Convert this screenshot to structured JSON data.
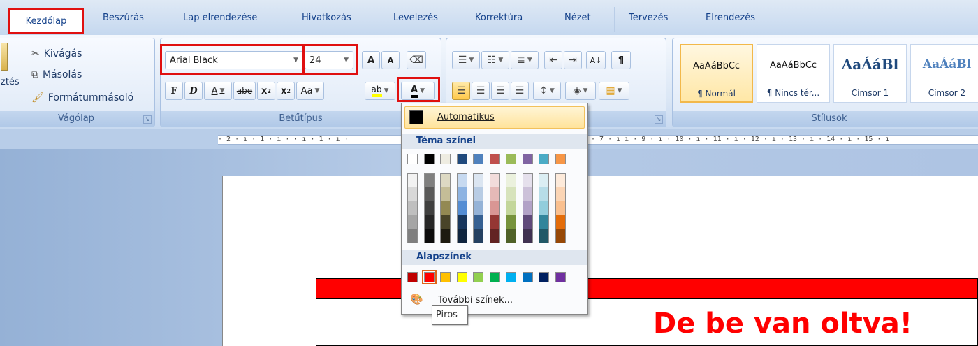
{
  "tabs": [
    "Kezdőlap",
    "Beszúrás",
    "Lap elrendezése",
    "Hivatkozás",
    "Levelezés",
    "Korrektúra",
    "Nézet",
    "Tervezés",
    "Elrendezés"
  ],
  "clipboard": {
    "paste_label": "ztés",
    "cut": "Kivágás",
    "copy": "Másolás",
    "format_painter": "Formátummásoló",
    "group_label": "Vágólap"
  },
  "font": {
    "name": "Arial Black",
    "size": "24",
    "grow": "A",
    "shrink": "A",
    "bold": "F",
    "italic": "D",
    "underline": "A",
    "strike": "abe",
    "subscript": "x",
    "superscript": "x",
    "change_case": "Aa",
    "highlight": "ab",
    "color_letter": "A",
    "group_label": "Betűtípus"
  },
  "paragraph": {
    "sort": "A↓",
    "pilcrow": "¶"
  },
  "styles": {
    "items": [
      {
        "sample": "AaÁáBbCc",
        "name": "¶ Normál"
      },
      {
        "sample": "AaÁáBbCc",
        "name": "¶ Nincs tér..."
      },
      {
        "sample": "AaÁáBl",
        "name": "Címsor 1"
      },
      {
        "sample": "AaÁáBl",
        "name": "Címsor 2"
      }
    ],
    "group_label": "Stílusok"
  },
  "ruler": {
    "left_text": "· 2 · ı · 1 · ı ·    · ı · 1 · ı ·",
    "right_text": "· 7 · ı        ı · 9 · ı · 10 · ı · 11 · ı · 12 · ı · 13 · ı · 14 · ı · 15 · ı"
  },
  "color_popup": {
    "automatic": "Automatikus",
    "theme_heading": "Téma színei",
    "theme_top": [
      "#ffffff",
      "#000000",
      "#eeece1",
      "#1f497d",
      "#4f81bd",
      "#c0504d",
      "#9bbb59",
      "#8064a2",
      "#4bacc6",
      "#f79646"
    ],
    "theme_shades": [
      [
        "#f2f2f2",
        "#d8d8d8",
        "#bfbfbf",
        "#a5a5a5",
        "#7f7f7f"
      ],
      [
        "#7f7f7f",
        "#595959",
        "#3f3f3f",
        "#262626",
        "#0c0c0c"
      ],
      [
        "#ddd9c3",
        "#c4bd97",
        "#938953",
        "#494429",
        "#1d1b10"
      ],
      [
        "#c6d9f0",
        "#8db3e2",
        "#548dd4",
        "#17365d",
        "#0f243e"
      ],
      [
        "#dbe5f1",
        "#b8cce4",
        "#95b3d7",
        "#366092",
        "#244061"
      ],
      [
        "#f2dcdb",
        "#e5b9b7",
        "#d99694",
        "#953734",
        "#632423"
      ],
      [
        "#ebf1dd",
        "#d7e3bc",
        "#c3d69b",
        "#76923c",
        "#4f6128"
      ],
      [
        "#e5e0ec",
        "#ccc1d9",
        "#b2a2c7",
        "#5f497a",
        "#3f3151"
      ],
      [
        "#dbeef3",
        "#b7dde8",
        "#92cddc",
        "#31859b",
        "#205867"
      ],
      [
        "#fdeada",
        "#fbd5b5",
        "#fac08f",
        "#e36c09",
        "#974806"
      ]
    ],
    "standard_heading": "Alapszínek",
    "standard": [
      "#c00000",
      "#ff0000",
      "#ffc000",
      "#ffff00",
      "#92d050",
      "#00b050",
      "#00b0f0",
      "#0070c0",
      "#002060",
      "#7030a0"
    ],
    "more_colors": "További színek...",
    "tooltip": "Piros"
  },
  "document": {
    "cell_text": "De be van oltva!"
  }
}
